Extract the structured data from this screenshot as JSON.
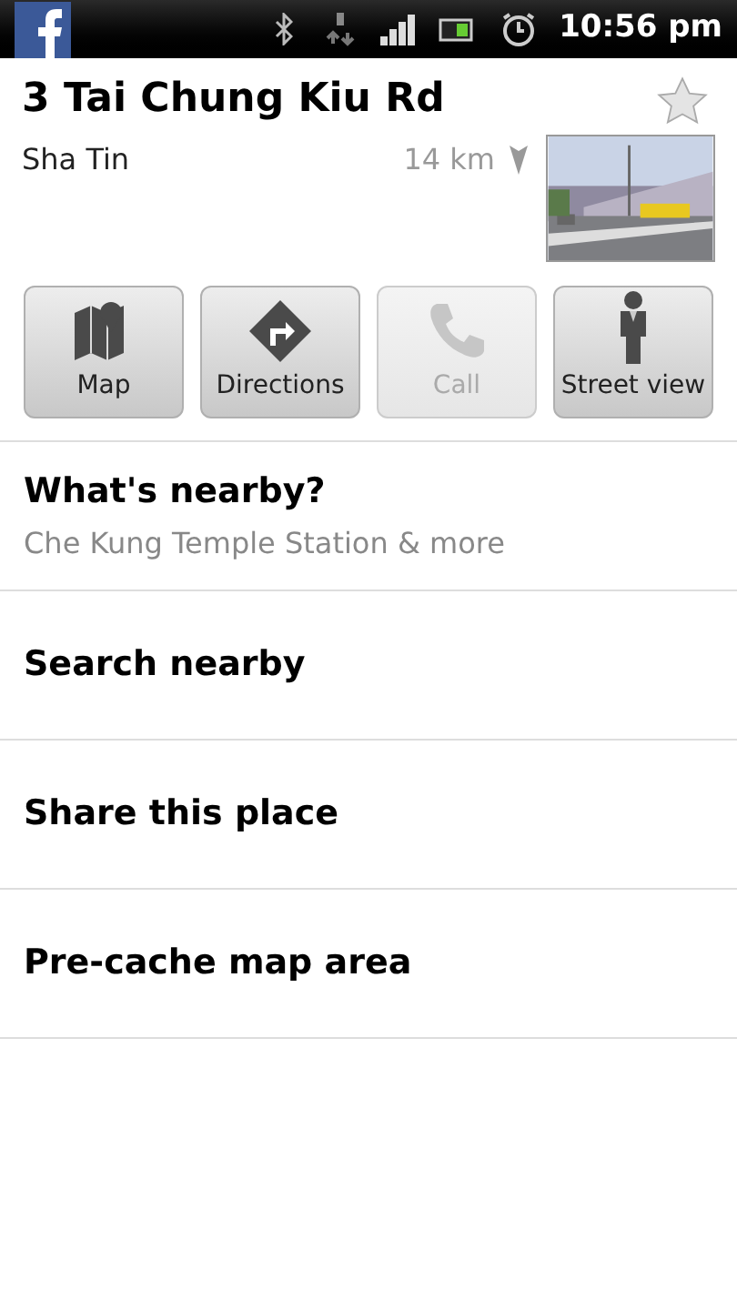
{
  "status_bar": {
    "time": "10:56 pm"
  },
  "place": {
    "title": "3 Tai Chung Kiu Rd",
    "area": "Sha Tin",
    "distance": "14 km",
    "starred": false
  },
  "actions": [
    {
      "kind": "map",
      "label": "Map",
      "disabled": false
    },
    {
      "kind": "directions",
      "label": "Directions",
      "disabled": false
    },
    {
      "kind": "call",
      "label": "Call",
      "disabled": true
    },
    {
      "kind": "streetview",
      "label": "Street view",
      "disabled": false
    }
  ],
  "menu": [
    {
      "label": "What's nearby?",
      "subtitle": "Che Kung Temple Station & more"
    },
    {
      "label": "Search nearby"
    },
    {
      "label": "Share this place"
    },
    {
      "label": "Pre-cache map area"
    }
  ]
}
